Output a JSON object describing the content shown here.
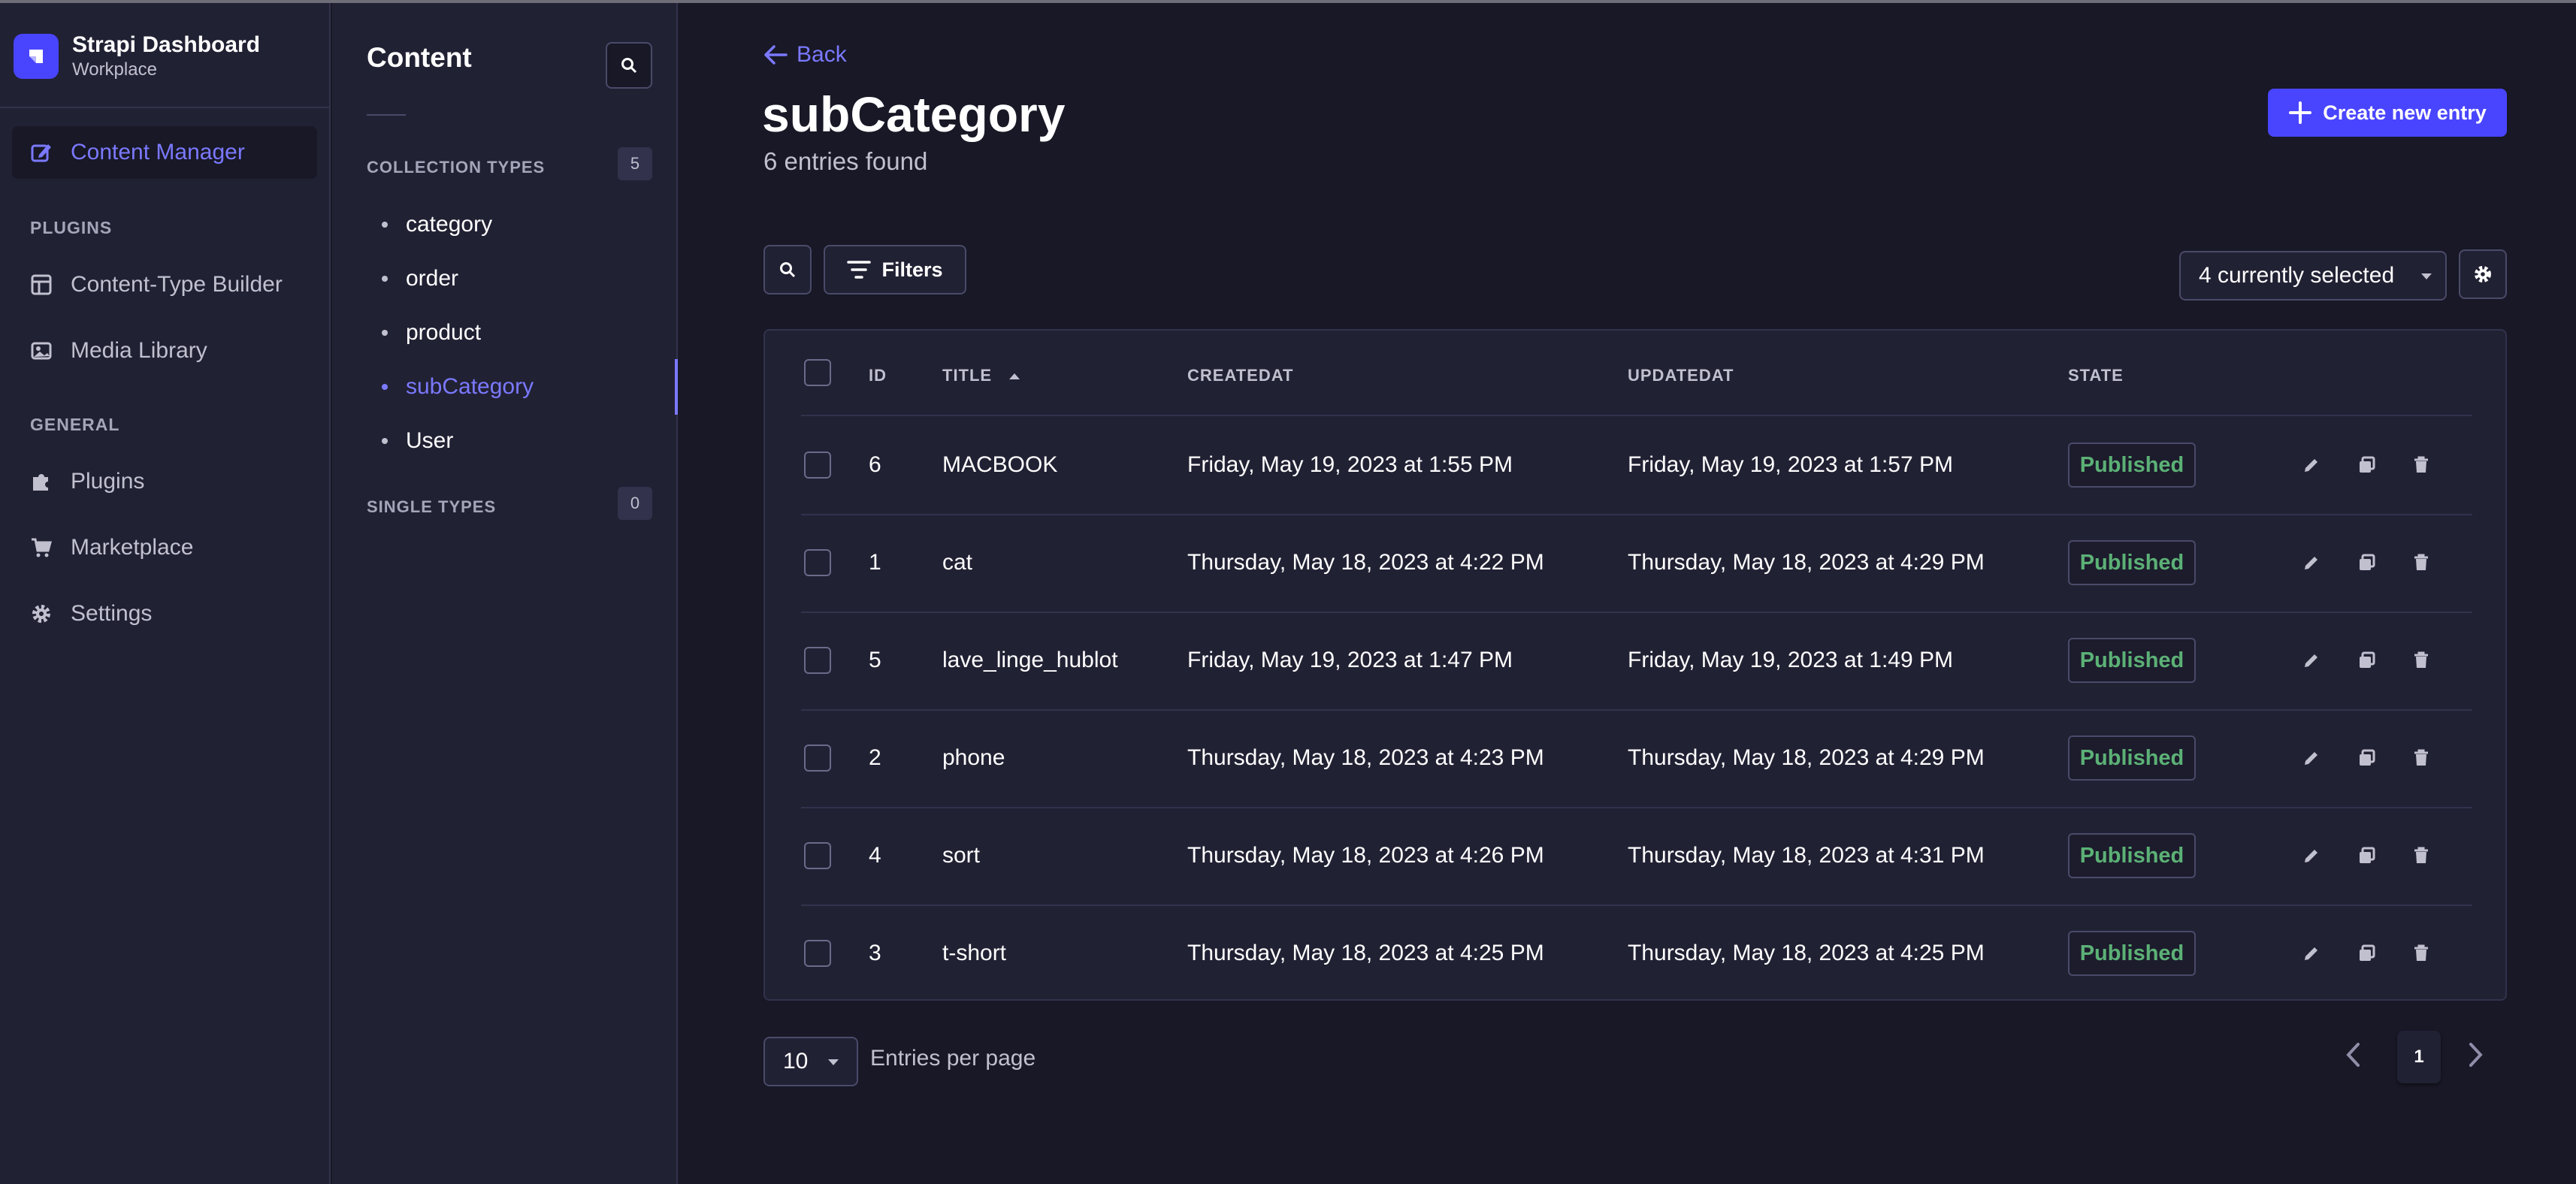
{
  "brand": {
    "title": "Strapi Dashboard",
    "subtitle": "Workplace"
  },
  "main_nav": {
    "active_item": "Content Manager",
    "sections": [
      {
        "label": "PLUGINS",
        "items": [
          "Content-Type Builder",
          "Media Library"
        ]
      },
      {
        "label": "GENERAL",
        "items": [
          "Plugins",
          "Marketplace",
          "Settings"
        ]
      }
    ]
  },
  "sub_nav": {
    "title": "Content",
    "collection_types": {
      "label": "COLLECTION TYPES",
      "count": "5",
      "items": [
        "category",
        "order",
        "product",
        "subCategory",
        "User"
      ],
      "active": "subCategory"
    },
    "single_types": {
      "label": "SINGLE TYPES",
      "count": "0"
    }
  },
  "header": {
    "back_label": "Back",
    "title": "subCategory",
    "subtitle": "6 entries found",
    "create_button": "Create new entry"
  },
  "toolbar": {
    "filters_label": "Filters",
    "columns_select": "4 currently selected"
  },
  "table": {
    "columns": [
      "ID",
      "TITLE",
      "CREATEDAT",
      "UPDATEDAT",
      "STATE"
    ],
    "sort_column": "TITLE",
    "sort_direction": "ascending",
    "rows": [
      {
        "id": "6",
        "title": "MACBOOK",
        "created": "Friday, May 19, 2023 at 1:55 PM",
        "updated": "Friday, May 19, 2023 at 1:57 PM",
        "state": "Published"
      },
      {
        "id": "1",
        "title": "cat",
        "created": "Thursday, May 18, 2023 at 4:22 PM",
        "updated": "Thursday, May 18, 2023 at 4:29 PM",
        "state": "Published"
      },
      {
        "id": "5",
        "title": "lave_linge_hublot",
        "created": "Friday, May 19, 2023 at 1:47 PM",
        "updated": "Friday, May 19, 2023 at 1:49 PM",
        "state": "Published"
      },
      {
        "id": "2",
        "title": "phone",
        "created": "Thursday, May 18, 2023 at 4:23 PM",
        "updated": "Thursday, May 18, 2023 at 4:29 PM",
        "state": "Published"
      },
      {
        "id": "4",
        "title": "sort",
        "created": "Thursday, May 18, 2023 at 4:26 PM",
        "updated": "Thursday, May 18, 2023 at 4:31 PM",
        "state": "Published"
      },
      {
        "id": "3",
        "title": "t-short",
        "created": "Thursday, May 18, 2023 at 4:25 PM",
        "updated": "Thursday, May 18, 2023 at 4:25 PM",
        "state": "Published"
      }
    ]
  },
  "footer": {
    "per_page_value": "10",
    "per_page_label": "Entries per page",
    "current_page": "1"
  },
  "icons": {
    "brand": "strapi-logo-icon",
    "content_manager": "pencil-note-icon",
    "content_type_builder": "layout-icon",
    "media_library": "image-icon",
    "plugins": "puzzle-icon",
    "marketplace": "cart-icon",
    "settings": "gear-icon",
    "row_actions": [
      "edit-icon",
      "duplicate-icon",
      "trash-icon"
    ]
  },
  "colors": {
    "background": "#181826",
    "panel": "#212134",
    "accent": "#4945ff",
    "accent_text": "#7b79ff",
    "published": "#5cb176"
  }
}
